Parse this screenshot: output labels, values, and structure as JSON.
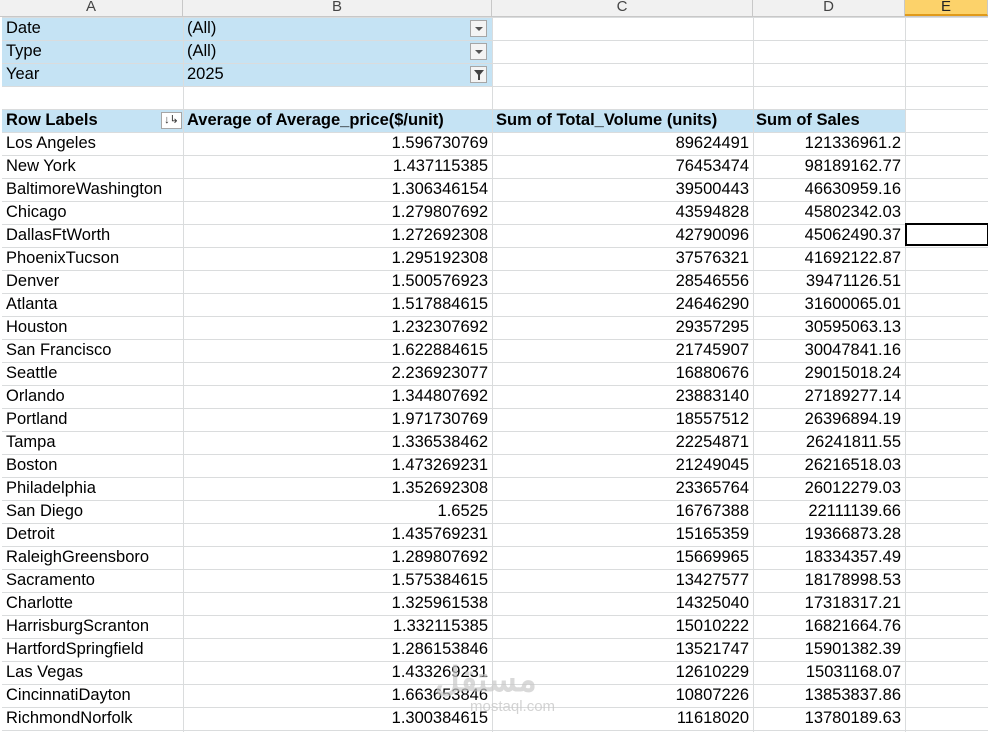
{
  "columns": [
    "A",
    "B",
    "C",
    "D",
    "E"
  ],
  "filters": [
    {
      "label": "Date",
      "value": "(All)",
      "control": "dropdown"
    },
    {
      "label": "Type",
      "value": "(All)",
      "control": "dropdown"
    },
    {
      "label": "Year",
      "value": "2025",
      "control": "filter-applied"
    }
  ],
  "pivot": {
    "headers": [
      "Row Labels",
      "Average of Average_price($/unit)",
      "Sum of Total_Volume (units)",
      "Sum of Sales"
    ],
    "rows": [
      [
        "Los Angeles",
        "1.596730769",
        "89624491",
        "121336961.2"
      ],
      [
        "New York",
        "1.437115385",
        "76453474",
        "98189162.77"
      ],
      [
        "BaltimoreWashington",
        "1.306346154",
        "39500443",
        "46630959.16"
      ],
      [
        "Chicago",
        "1.279807692",
        "43594828",
        "45802342.03"
      ],
      [
        "DallasFtWorth",
        "1.272692308",
        "42790096",
        "45062490.37"
      ],
      [
        "PhoenixTucson",
        "1.295192308",
        "37576321",
        "41692122.87"
      ],
      [
        "Denver",
        "1.500576923",
        "28546556",
        "39471126.51"
      ],
      [
        "Atlanta",
        "1.517884615",
        "24646290",
        "31600065.01"
      ],
      [
        "Houston",
        "1.232307692",
        "29357295",
        "30595063.13"
      ],
      [
        "San Francisco",
        "1.622884615",
        "21745907",
        "30047841.16"
      ],
      [
        "Seattle",
        "2.236923077",
        "16880676",
        "29015018.24"
      ],
      [
        "Orlando",
        "1.344807692",
        "23883140",
        "27189277.14"
      ],
      [
        "Portland",
        "1.971730769",
        "18557512",
        "26396894.19"
      ],
      [
        "Tampa",
        "1.336538462",
        "22254871",
        "26241811.55"
      ],
      [
        "Boston",
        "1.473269231",
        "21249045",
        "26216518.03"
      ],
      [
        "Philadelphia",
        "1.352692308",
        "23365764",
        "26012279.03"
      ],
      [
        "San Diego",
        "1.6525",
        "16767388",
        "22111139.66"
      ],
      [
        "Detroit",
        "1.435769231",
        "15165359",
        "19366873.28"
      ],
      [
        "RaleighGreensboro",
        "1.289807692",
        "15669965",
        "18334357.49"
      ],
      [
        "Sacramento",
        "1.575384615",
        "13427577",
        "18178998.53"
      ],
      [
        "Charlotte",
        "1.325961538",
        "14325040",
        "17318317.21"
      ],
      [
        "HarrisburgScranton",
        "1.332115385",
        "15010222",
        "16821664.76"
      ],
      [
        "HartfordSpringfield",
        "1.286153846",
        "13521747",
        "15901382.39"
      ],
      [
        "Las Vegas",
        "1.433269231",
        "12610229",
        "15031168.07"
      ],
      [
        "CincinnatiDayton",
        "1.663653846",
        "10807226",
        "13853837.86"
      ],
      [
        "RichmondNorfolk",
        "1.300384615",
        "11618020",
        "13780189.63"
      ]
    ]
  },
  "sort_icon": "sort-descending-icon",
  "selected_column": "E",
  "watermark": {
    "main": "مستقل",
    "sub": "mostaql.com"
  },
  "colors": {
    "header_fill": "#c5e3f4",
    "selected_column": "#fcd26a",
    "gridline": "#dadcdd"
  }
}
